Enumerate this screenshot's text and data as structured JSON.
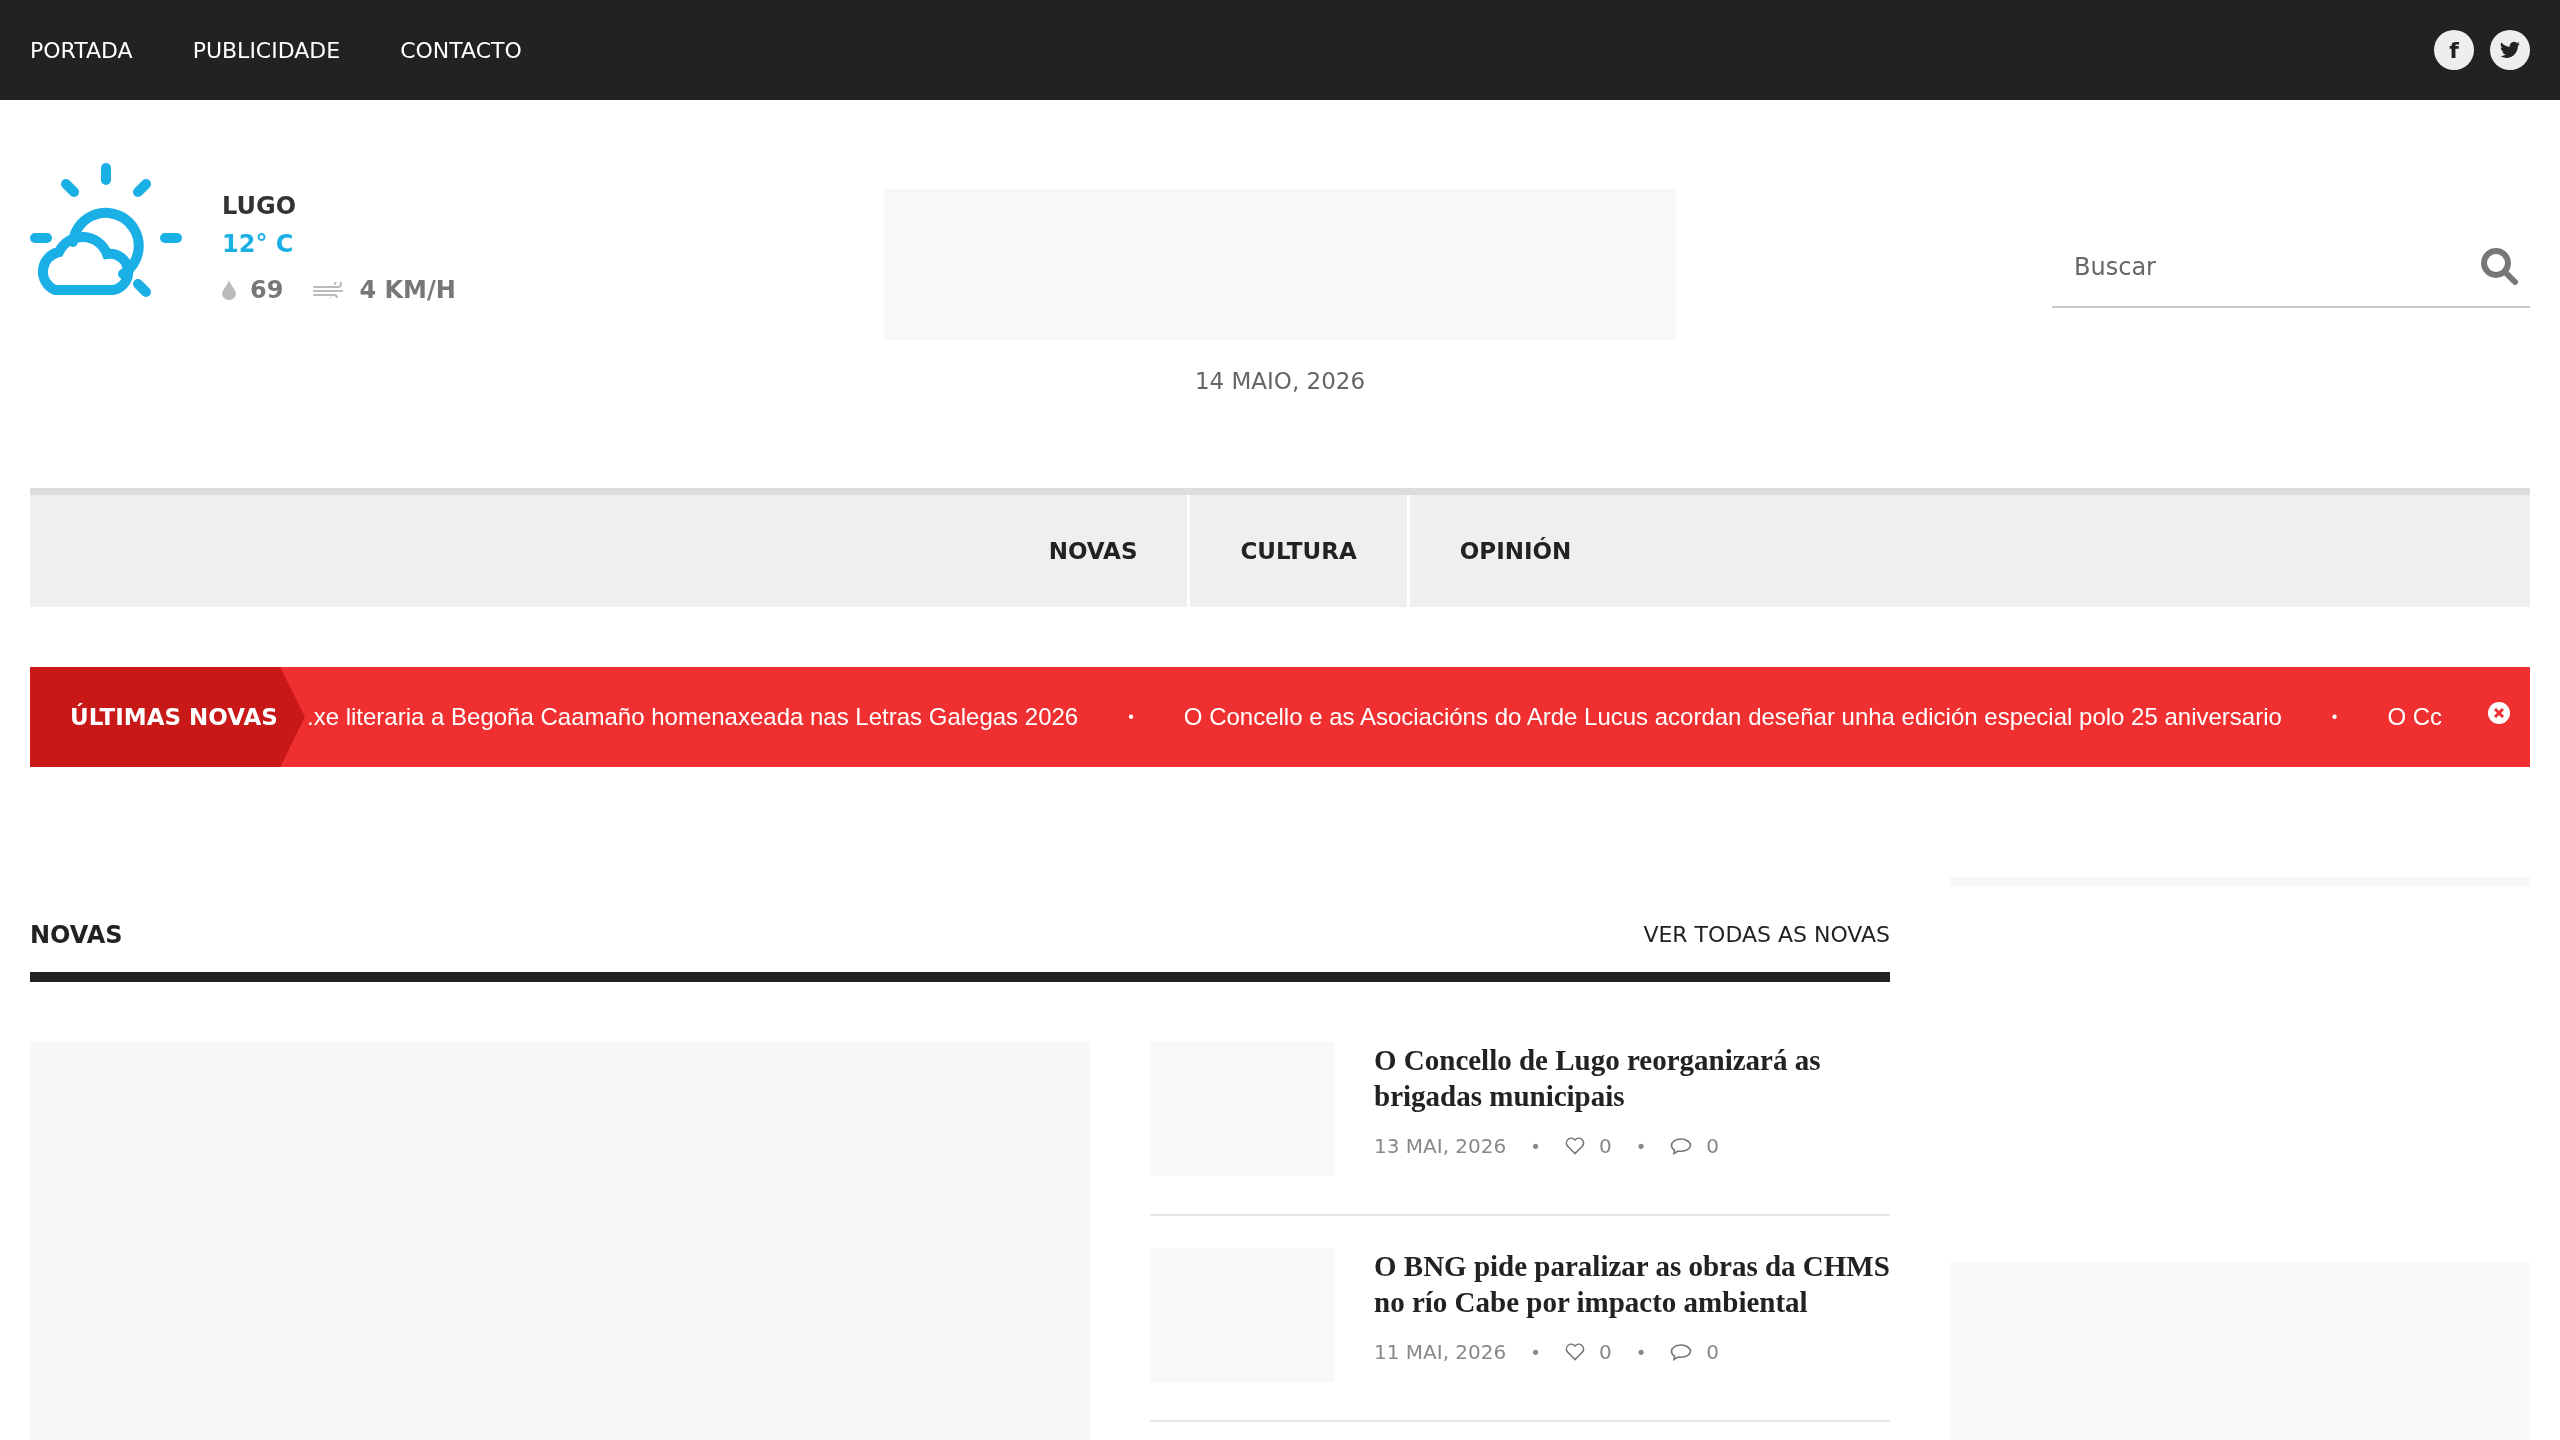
{
  "top_nav": {
    "links": [
      "PORTADA",
      "PUBLICIDADE",
      "CONTACTO"
    ],
    "social": [
      {
        "kind": "facebook",
        "label": "f"
      },
      {
        "kind": "twitter"
      }
    ]
  },
  "weather": {
    "city": "LUGO",
    "temperature": "12° C",
    "humidity": "69",
    "wind": "4 KM/H"
  },
  "date": "14 MAIO, 2026",
  "search": {
    "placeholder": "Buscar"
  },
  "main_nav": [
    {
      "label": "NOVAS"
    },
    {
      "label": "CULTURA"
    },
    {
      "label": "OPINIÓN"
    }
  ],
  "ticker": {
    "label": "ÚLTIMAS NOVAS",
    "items": [
      {
        "kind": "headline",
        "text": ".xe literaria a Begoña Caamaño homenaxeada nas Letras Galegas 2026"
      },
      {
        "kind": "bullet",
        "text": "•"
      },
      {
        "kind": "headline",
        "text": "O Concello e as Asociacións do Arde Lucus acordan deseñar unha edición especial polo 25 aniversario"
      },
      {
        "kind": "bullet",
        "text": "•"
      },
      {
        "kind": "headline",
        "text": "O Cc"
      }
    ]
  },
  "section": {
    "title": "NOVAS",
    "link": "VER TODAS AS NOVAS"
  },
  "articles": [
    {
      "title": "O Concello de Lugo reorganizará as brigadas municipais",
      "meta": [
        {
          "kind": "date",
          "text": "13 MAI, 2026"
        },
        {
          "kind": "bullet",
          "text": "•"
        },
        {
          "kind": "likes",
          "text": "0"
        },
        {
          "kind": "bullet",
          "text": "•"
        },
        {
          "kind": "comments",
          "text": "0"
        }
      ]
    },
    {
      "title": "O BNG pide paralizar as obras da CHMS no río Cabe por impacto ambiental",
      "meta": [
        {
          "kind": "date",
          "text": "11 MAI, 2026"
        },
        {
          "kind": "bullet",
          "text": "•"
        },
        {
          "kind": "likes",
          "text": "0"
        },
        {
          "kind": "bullet",
          "text": "•"
        },
        {
          "kind": "comments",
          "text": "0"
        }
      ]
    }
  ]
}
